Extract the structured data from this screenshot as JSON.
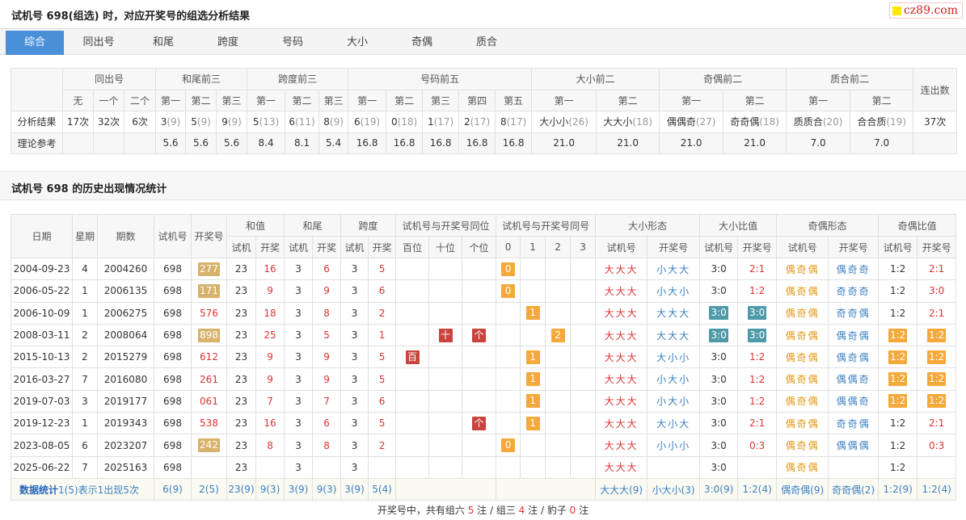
{
  "page_title": "试机号 698(组选) 时，对应开奖号的组选分析结果",
  "logo_text": "cz89.com",
  "tabs": [
    "综合",
    "同出号",
    "和尾",
    "跨度",
    "号码",
    "大小",
    "奇偶",
    "质合"
  ],
  "summary": {
    "groups": [
      "同出号",
      "和尾前三",
      "跨度前三",
      "号码前五",
      "大小前二",
      "奇偶前二",
      "质合前二",
      "连出数"
    ],
    "subs": [
      "无",
      "一个",
      "二个",
      "第一",
      "第二",
      "第三",
      "第一",
      "第二",
      "第三",
      "第一",
      "第二",
      "第三",
      "第四",
      "第五",
      "第一",
      "第二",
      "第一",
      "第二",
      "第一",
      "第二"
    ],
    "row1_label": "分析结果",
    "row1": [
      [
        "17次",
        ""
      ],
      [
        "32次",
        ""
      ],
      [
        "6次",
        ""
      ],
      [
        "3",
        "(9)"
      ],
      [
        "5",
        "(9)"
      ],
      [
        "9",
        "(9)"
      ],
      [
        "5",
        "(13)"
      ],
      [
        "6",
        "(11)"
      ],
      [
        "8",
        "(9)"
      ],
      [
        "6",
        "(19)"
      ],
      [
        "0",
        "(18)"
      ],
      [
        "1",
        "(17)"
      ],
      [
        "2",
        "(17)"
      ],
      [
        "8",
        "(17)"
      ],
      [
        "大小小",
        "(26)"
      ],
      [
        "大大小",
        "(18)"
      ],
      [
        "偶偶奇",
        "(27)"
      ],
      [
        "奇奇偶",
        "(18)"
      ],
      [
        "质质合",
        "(20)"
      ],
      [
        "合合质",
        "(19)"
      ],
      [
        "37次",
        ""
      ]
    ],
    "row2_label": "理论参考",
    "row2": [
      "",
      "",
      "",
      "5.6",
      "5.6",
      "5.6",
      "8.4",
      "8.1",
      "5.4",
      "16.8",
      "16.8",
      "16.8",
      "16.8",
      "16.8",
      "21.0",
      "21.0",
      "21.0",
      "21.0",
      "7.0",
      "7.0",
      ""
    ]
  },
  "history_title": "试机号 698 的历史出现情况统计",
  "history": {
    "head1": [
      "日期",
      "星期",
      "期数",
      "试机号",
      "开奖号",
      "和值",
      "和尾",
      "跨度",
      "试机号与开奖号同位",
      "试机号与开奖号同号",
      "大小形态",
      "大小比值",
      "奇偶形态",
      "奇偶比值"
    ],
    "head2": [
      "试机",
      "开奖",
      "试机",
      "开奖",
      "试机",
      "开奖",
      "百位",
      "十位",
      "个位",
      "0",
      "1",
      "2",
      "3",
      "试机号",
      "开奖号",
      "试机号",
      "开奖号",
      "试机号",
      "开奖号",
      "试机号",
      "开奖号"
    ],
    "rows": [
      {
        "date": "2004-09-23",
        "wk": "4",
        "qi": "2004260",
        "sj": "698",
        "kj": "277",
        "kjb": "gold",
        "hs": "23",
        "hk": "16",
        "ws": "3",
        "wk2": "6",
        "ks": "3",
        "kk": "5",
        "bw": "",
        "sw": "",
        "gw": "",
        "t0": "0",
        "t1": "",
        "t2": "",
        "t3": "",
        "dxs": "大大大",
        "dxk": "小大大",
        "dbs": "3:0",
        "dbk": "2:1",
        "dbsb": "",
        "dbkb": "",
        "jos": "偶奇偶",
        "jok": "偶奇奇",
        "jbs": "1:2",
        "jbk": "2:1",
        "jbsb": "",
        "jbkb": ""
      },
      {
        "date": "2006-05-22",
        "wk": "1",
        "qi": "2006135",
        "sj": "698",
        "kj": "171",
        "kjb": "gold",
        "hs": "23",
        "hk": "9",
        "ws": "3",
        "wk2": "9",
        "ks": "3",
        "kk": "6",
        "bw": "",
        "sw": "",
        "gw": "",
        "t0": "0",
        "t1": "",
        "t2": "",
        "t3": "",
        "dxs": "大大大",
        "dxk": "小大小",
        "dbs": "3:0",
        "dbk": "1:2",
        "dbsb": "",
        "dbkb": "",
        "jos": "偶奇偶",
        "jok": "奇奇奇",
        "jbs": "1:2",
        "jbk": "3:0",
        "jbsb": "",
        "jbkb": ""
      },
      {
        "date": "2006-10-09",
        "wk": "1",
        "qi": "2006275",
        "sj": "698",
        "kj": "576",
        "kjb": "",
        "hs": "23",
        "hk": "18",
        "ws": "3",
        "wk2": "8",
        "ks": "3",
        "kk": "2",
        "bw": "",
        "sw": "",
        "gw": "",
        "t0": "",
        "t1": "1",
        "t2": "",
        "t3": "",
        "dxs": "大大大",
        "dxk": "大大大",
        "dbs": "3:0",
        "dbk": "3:0",
        "dbsb": "teal",
        "dbkb": "teal",
        "jos": "偶奇偶",
        "jok": "奇奇偶",
        "jbs": "1:2",
        "jbk": "2:1",
        "jbsb": "",
        "jbkb": ""
      },
      {
        "date": "2008-03-11",
        "wk": "2",
        "qi": "2008064",
        "sj": "698",
        "kj": "898",
        "kjb": "gold",
        "hs": "23",
        "hk": "25",
        "ws": "3",
        "wk2": "5",
        "ks": "3",
        "kk": "1",
        "bw": "",
        "sw": "十",
        "gw": "个",
        "t0": "",
        "t1": "",
        "t2": "2",
        "t3": "",
        "dxs": "大大大",
        "dxk": "大大大",
        "dbs": "3:0",
        "dbk": "3:0",
        "dbsb": "teal",
        "dbkb": "teal",
        "jos": "偶奇偶",
        "jok": "偶奇偶",
        "jbs": "1:2",
        "jbk": "1:2",
        "jbsb": "or",
        "jbkb": "or"
      },
      {
        "date": "2015-10-13",
        "wk": "2",
        "qi": "2015279",
        "sj": "698",
        "kj": "612",
        "kjb": "",
        "hs": "23",
        "hk": "9",
        "ws": "3",
        "wk2": "9",
        "ks": "3",
        "kk": "5",
        "bw": "百",
        "sw": "",
        "gw": "",
        "t0": "",
        "t1": "1",
        "t2": "",
        "t3": "",
        "dxs": "大大大",
        "dxk": "大小小",
        "dbs": "3:0",
        "dbk": "1:2",
        "dbsb": "",
        "dbkb": "",
        "jos": "偶奇偶",
        "jok": "偶奇偶",
        "jbs": "1:2",
        "jbk": "1:2",
        "jbsb": "or",
        "jbkb": "or"
      },
      {
        "date": "2016-03-27",
        "wk": "7",
        "qi": "2016080",
        "sj": "698",
        "kj": "261",
        "kjb": "",
        "hs": "23",
        "hk": "9",
        "ws": "3",
        "wk2": "9",
        "ks": "3",
        "kk": "5",
        "bw": "",
        "sw": "",
        "gw": "",
        "t0": "",
        "t1": "1",
        "t2": "",
        "t3": "",
        "dxs": "大大大",
        "dxk": "小大小",
        "dbs": "3:0",
        "dbk": "1:2",
        "dbsb": "",
        "dbkb": "",
        "jos": "偶奇偶",
        "jok": "偶偶奇",
        "jbs": "1:2",
        "jbk": "1:2",
        "jbsb": "or",
        "jbkb": "or"
      },
      {
        "date": "2019-07-03",
        "wk": "3",
        "qi": "2019177",
        "sj": "698",
        "kj": "061",
        "kjb": "",
        "hs": "23",
        "hk": "7",
        "ws": "3",
        "wk2": "7",
        "ks": "3",
        "kk": "6",
        "bw": "",
        "sw": "",
        "gw": "",
        "t0": "",
        "t1": "1",
        "t2": "",
        "t3": "",
        "dxs": "大大大",
        "dxk": "小大小",
        "dbs": "3:0",
        "dbk": "1:2",
        "dbsb": "",
        "dbkb": "",
        "jos": "偶奇偶",
        "jok": "偶偶奇",
        "jbs": "1:2",
        "jbk": "1:2",
        "jbsb": "or",
        "jbkb": "or"
      },
      {
        "date": "2019-12-23",
        "wk": "1",
        "qi": "2019343",
        "sj": "698",
        "kj": "538",
        "kjb": "",
        "hs": "23",
        "hk": "16",
        "ws": "3",
        "wk2": "6",
        "ks": "3",
        "kk": "5",
        "bw": "",
        "sw": "",
        "gw": "个",
        "t0": "",
        "t1": "1",
        "t2": "",
        "t3": "",
        "dxs": "大大大",
        "dxk": "大小大",
        "dbs": "3:0",
        "dbk": "2:1",
        "dbsb": "",
        "dbkb": "",
        "jos": "偶奇偶",
        "jok": "奇奇偶",
        "jbs": "1:2",
        "jbk": "2:1",
        "jbsb": "",
        "jbkb": ""
      },
      {
        "date": "2023-08-05",
        "wk": "6",
        "qi": "2023207",
        "sj": "698",
        "kj": "242",
        "kjb": "gold",
        "hs": "23",
        "hk": "8",
        "ws": "3",
        "wk2": "8",
        "ks": "3",
        "kk": "2",
        "bw": "",
        "sw": "",
        "gw": "",
        "t0": "0",
        "t1": "",
        "t2": "",
        "t3": "",
        "dxs": "大大大",
        "dxk": "小小小",
        "dbs": "3:0",
        "dbk": "0:3",
        "dbsb": "",
        "dbkb": "",
        "jos": "偶奇偶",
        "jok": "偶偶偶",
        "jbs": "1:2",
        "jbk": "0:3",
        "jbsb": "",
        "jbkb": ""
      },
      {
        "date": "2025-06-22",
        "wk": "7",
        "qi": "2025163",
        "sj": "698",
        "kj": "",
        "kjb": "",
        "hs": "23",
        "hk": "",
        "ws": "3",
        "wk2": "",
        "ks": "3",
        "kk": "",
        "bw": "",
        "sw": "",
        "gw": "",
        "t0": "",
        "t1": "",
        "t2": "",
        "t3": "",
        "dxs": "大大大",
        "dxk": "",
        "dbs": "3:0",
        "dbk": "",
        "dbsb": "",
        "dbkb": "",
        "jos": "偶奇偶",
        "jok": "",
        "jbs": "1:2",
        "jbk": "",
        "jbsb": "",
        "jbkb": ""
      }
    ],
    "stats_label": "数据统计",
    "stats_note": "1(5)表示1出现5次",
    "stats": {
      "sj": "6(9)",
      "kj": "2(5)",
      "hs": "23(9)",
      "hk": "9(3)",
      "ws": "3(9)",
      "wk2": "9(3)",
      "ks": "3(9)",
      "kk": "5(4)",
      "dxs": "大大大(9)",
      "dxk": "小大小(3)",
      "dbs": "3:0(9)",
      "dbk": "1:2(4)",
      "jos": "偶奇偶(9)",
      "jok": "奇奇偶(2)",
      "jbs": "1:2(9)",
      "jbk": "1:2(4)"
    }
  },
  "footer": {
    "pre": "开奖号中，共有组六",
    "n6": "5",
    "mid1": "注 / 组三",
    "n3": "4",
    "mid2": "注 / 豹子",
    "nb": "0",
    "post": "注"
  }
}
